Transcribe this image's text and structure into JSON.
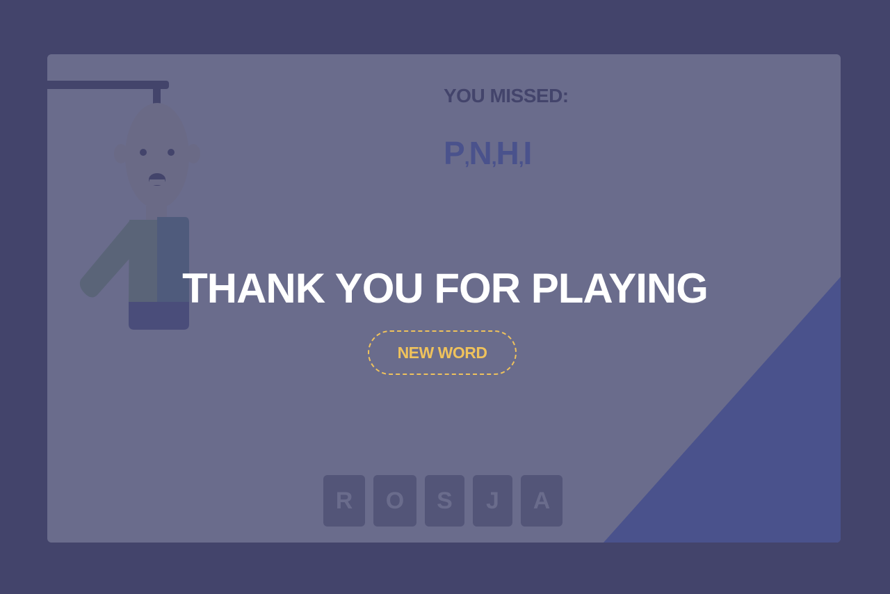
{
  "game": {
    "missed_title": "YOU MISSED:",
    "missed_letters": [
      "P",
      "N",
      "H",
      "I"
    ],
    "word_tiles": [
      "R",
      "O",
      "S",
      "J",
      "A"
    ],
    "headline": "THANK YOU FOR PLAYING",
    "new_word_label": "NEW WORD"
  },
  "colors": {
    "page_bg": "#43446b",
    "card_bg": "#6a6c8c",
    "corner_accent": "#4a528c",
    "button_accent": "#efc25c",
    "headline_text": "#ffffff"
  },
  "icons": [
    "gallows-icon",
    "hangman-figure-icon"
  ]
}
